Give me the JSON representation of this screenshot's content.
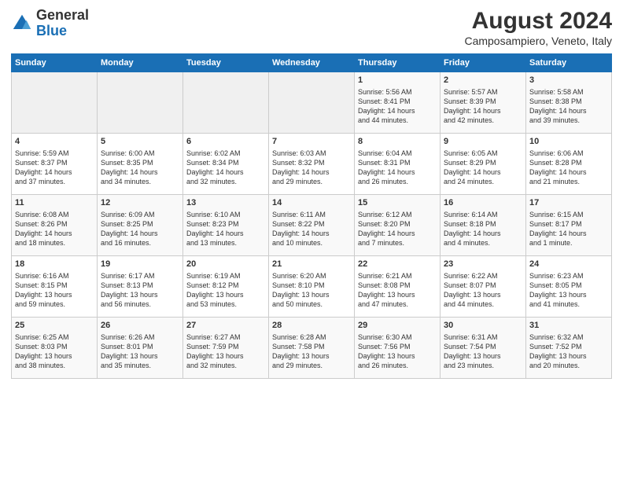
{
  "logo": {
    "general": "General",
    "blue": "Blue"
  },
  "header": {
    "title": "August 2024",
    "subtitle": "Camposampiero, Veneto, Italy"
  },
  "days_of_week": [
    "Sunday",
    "Monday",
    "Tuesday",
    "Wednesday",
    "Thursday",
    "Friday",
    "Saturday"
  ],
  "weeks": [
    [
      {
        "day": "",
        "info": ""
      },
      {
        "day": "",
        "info": ""
      },
      {
        "day": "",
        "info": ""
      },
      {
        "day": "",
        "info": ""
      },
      {
        "day": "1",
        "info": "Sunrise: 5:56 AM\nSunset: 8:41 PM\nDaylight: 14 hours\nand 44 minutes."
      },
      {
        "day": "2",
        "info": "Sunrise: 5:57 AM\nSunset: 8:39 PM\nDaylight: 14 hours\nand 42 minutes."
      },
      {
        "day": "3",
        "info": "Sunrise: 5:58 AM\nSunset: 8:38 PM\nDaylight: 14 hours\nand 39 minutes."
      }
    ],
    [
      {
        "day": "4",
        "info": "Sunrise: 5:59 AM\nSunset: 8:37 PM\nDaylight: 14 hours\nand 37 minutes."
      },
      {
        "day": "5",
        "info": "Sunrise: 6:00 AM\nSunset: 8:35 PM\nDaylight: 14 hours\nand 34 minutes."
      },
      {
        "day": "6",
        "info": "Sunrise: 6:02 AM\nSunset: 8:34 PM\nDaylight: 14 hours\nand 32 minutes."
      },
      {
        "day": "7",
        "info": "Sunrise: 6:03 AM\nSunset: 8:32 PM\nDaylight: 14 hours\nand 29 minutes."
      },
      {
        "day": "8",
        "info": "Sunrise: 6:04 AM\nSunset: 8:31 PM\nDaylight: 14 hours\nand 26 minutes."
      },
      {
        "day": "9",
        "info": "Sunrise: 6:05 AM\nSunset: 8:29 PM\nDaylight: 14 hours\nand 24 minutes."
      },
      {
        "day": "10",
        "info": "Sunrise: 6:06 AM\nSunset: 8:28 PM\nDaylight: 14 hours\nand 21 minutes."
      }
    ],
    [
      {
        "day": "11",
        "info": "Sunrise: 6:08 AM\nSunset: 8:26 PM\nDaylight: 14 hours\nand 18 minutes."
      },
      {
        "day": "12",
        "info": "Sunrise: 6:09 AM\nSunset: 8:25 PM\nDaylight: 14 hours\nand 16 minutes."
      },
      {
        "day": "13",
        "info": "Sunrise: 6:10 AM\nSunset: 8:23 PM\nDaylight: 14 hours\nand 13 minutes."
      },
      {
        "day": "14",
        "info": "Sunrise: 6:11 AM\nSunset: 8:22 PM\nDaylight: 14 hours\nand 10 minutes."
      },
      {
        "day": "15",
        "info": "Sunrise: 6:12 AM\nSunset: 8:20 PM\nDaylight: 14 hours\nand 7 minutes."
      },
      {
        "day": "16",
        "info": "Sunrise: 6:14 AM\nSunset: 8:18 PM\nDaylight: 14 hours\nand 4 minutes."
      },
      {
        "day": "17",
        "info": "Sunrise: 6:15 AM\nSunset: 8:17 PM\nDaylight: 14 hours\nand 1 minute."
      }
    ],
    [
      {
        "day": "18",
        "info": "Sunrise: 6:16 AM\nSunset: 8:15 PM\nDaylight: 13 hours\nand 59 minutes."
      },
      {
        "day": "19",
        "info": "Sunrise: 6:17 AM\nSunset: 8:13 PM\nDaylight: 13 hours\nand 56 minutes."
      },
      {
        "day": "20",
        "info": "Sunrise: 6:19 AM\nSunset: 8:12 PM\nDaylight: 13 hours\nand 53 minutes."
      },
      {
        "day": "21",
        "info": "Sunrise: 6:20 AM\nSunset: 8:10 PM\nDaylight: 13 hours\nand 50 minutes."
      },
      {
        "day": "22",
        "info": "Sunrise: 6:21 AM\nSunset: 8:08 PM\nDaylight: 13 hours\nand 47 minutes."
      },
      {
        "day": "23",
        "info": "Sunrise: 6:22 AM\nSunset: 8:07 PM\nDaylight: 13 hours\nand 44 minutes."
      },
      {
        "day": "24",
        "info": "Sunrise: 6:23 AM\nSunset: 8:05 PM\nDaylight: 13 hours\nand 41 minutes."
      }
    ],
    [
      {
        "day": "25",
        "info": "Sunrise: 6:25 AM\nSunset: 8:03 PM\nDaylight: 13 hours\nand 38 minutes."
      },
      {
        "day": "26",
        "info": "Sunrise: 6:26 AM\nSunset: 8:01 PM\nDaylight: 13 hours\nand 35 minutes."
      },
      {
        "day": "27",
        "info": "Sunrise: 6:27 AM\nSunset: 7:59 PM\nDaylight: 13 hours\nand 32 minutes."
      },
      {
        "day": "28",
        "info": "Sunrise: 6:28 AM\nSunset: 7:58 PM\nDaylight: 13 hours\nand 29 minutes."
      },
      {
        "day": "29",
        "info": "Sunrise: 6:30 AM\nSunset: 7:56 PM\nDaylight: 13 hours\nand 26 minutes."
      },
      {
        "day": "30",
        "info": "Sunrise: 6:31 AM\nSunset: 7:54 PM\nDaylight: 13 hours\nand 23 minutes."
      },
      {
        "day": "31",
        "info": "Sunrise: 6:32 AM\nSunset: 7:52 PM\nDaylight: 13 hours\nand 20 minutes."
      }
    ]
  ]
}
